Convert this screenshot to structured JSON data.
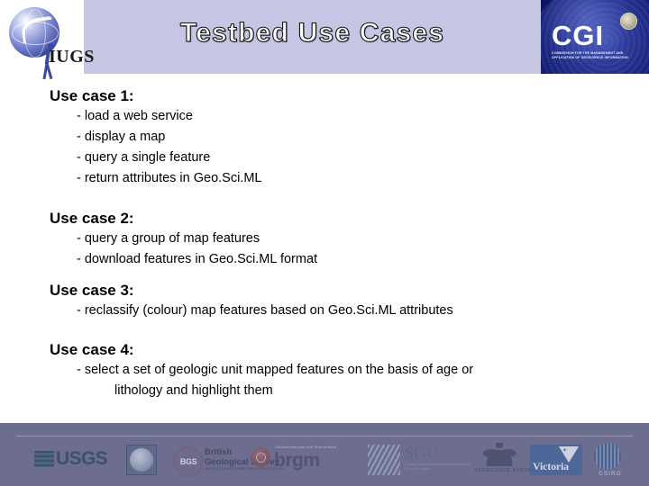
{
  "header": {
    "title": "Testbed Use Cases",
    "left_logo": {
      "name": "IUGS",
      "wordmark": "IUGS"
    },
    "right_logo": {
      "name": "CGI",
      "wordmark": "CGI",
      "subtitle": "Commission for the Management and Application of Geoscience Information"
    },
    "band_color": "#c4c6e4",
    "title_color": "#ffffff",
    "title_outline_color": "#111111"
  },
  "content": {
    "use_cases": [
      {
        "heading": "Use case 1:",
        "items": [
          "- load a web service",
          "- display a map",
          "- query a single feature",
          "- return attributes in Geo.Sci.ML"
        ]
      },
      {
        "heading": "Use case 2:",
        "items": [
          "- query a group of map features",
          "- download features in Geo.Sci.ML format"
        ]
      },
      {
        "heading": "Use case 3:",
        "items": [
          "- reclassify (colour) map features based on Geo.Sci.ML attributes"
        ]
      },
      {
        "heading": "Use case 4:",
        "items": [
          "- select a set of geologic unit mapped features on the basis of age or"
        ],
        "continuation": "lithology and highlight them"
      }
    ]
  },
  "footer": {
    "background_color": "#6d6d8f",
    "logos": [
      {
        "id": "usgs",
        "wordmark": "USGS"
      },
      {
        "id": "seal",
        "wordmark": ""
      },
      {
        "id": "bgs",
        "wordmark": "British\nGeological Survey",
        "line1": "British",
        "line2": "Geological Survey",
        "sub": "Natural Environment Research Council",
        "mark": "BGS"
      },
      {
        "id": "brgm",
        "wordmark": "brgm",
        "tag": "Geosciences pour une Terre durable"
      },
      {
        "id": "sgu",
        "wordmark": "SGU",
        "sub": "Sveriges geologiska undersokning Geological Survey of Sweden"
      },
      {
        "id": "geoscience-australia",
        "wordmark": "GEOSCIENCE AUSTRALIA"
      },
      {
        "id": "victoria",
        "wordmark": "Victoria"
      },
      {
        "id": "csiro",
        "wordmark": "CSIRO"
      }
    ]
  }
}
